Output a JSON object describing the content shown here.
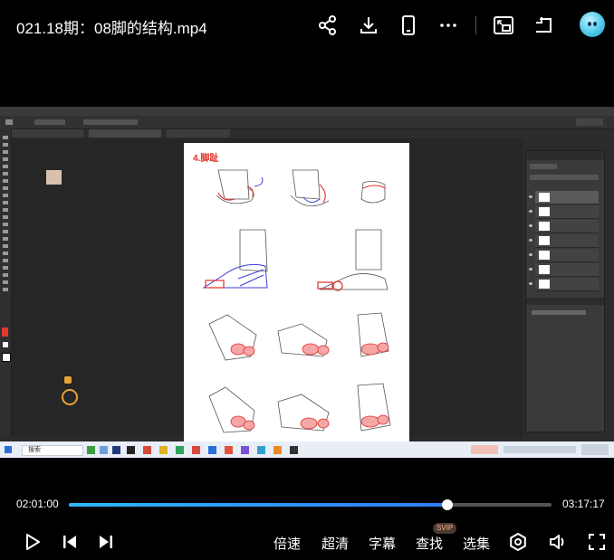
{
  "header": {
    "title": "021.18期：08脚的结构.mp4"
  },
  "drawing": {
    "heading": "4.脚趾"
  },
  "taskbar": {
    "search_text": "搜索"
  },
  "player": {
    "current_time": "02:01:00",
    "duration": "03:17:17",
    "progress": 0.785,
    "controls": {
      "speed_label": "倍速",
      "quality_label": "超清",
      "subtitle_label": "字幕",
      "find_label": "查找",
      "find_badge": "SVIP",
      "episodes_label": "选集"
    }
  },
  "colors": {
    "progress_start": "#2fb6ff",
    "progress_end": "#2e7dff",
    "sketch_red": "#e0302a",
    "sketch_blue": "#3b3bd6"
  },
  "icons": {
    "share": "share-icon",
    "download": "download-icon",
    "phone": "phone-icon",
    "more": "more-icon",
    "pip": "picture-in-picture-icon",
    "mini": "mini-window-icon",
    "play": "play-icon",
    "prev": "previous-icon",
    "next": "next-icon",
    "settings": "settings-icon",
    "volume": "volume-icon",
    "fullscreen": "fullscreen-icon"
  }
}
